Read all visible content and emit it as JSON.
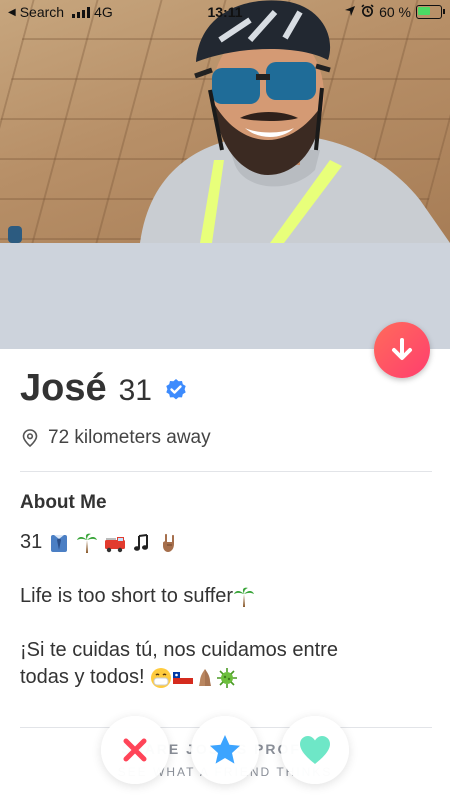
{
  "status_bar": {
    "back_label": "Search",
    "network": "4G",
    "time": "13:11",
    "battery": "60 %",
    "battery_level": 0.6
  },
  "profile": {
    "name": "José",
    "age": "31",
    "distance": "72 kilometers away"
  },
  "about": {
    "title": "About Me",
    "line1_text": "31",
    "line2": "Life is too short to suffer",
    "line3a": "¡Si te cuidas tú, nos cuidamos entre",
    "line3b": "todas y todos!"
  },
  "share": {
    "title": "SHARE JOSÉ'S PROFILE",
    "subtitle": "SEE WHAT A FRIEND THINKS"
  },
  "icons": {
    "verified": "verified-badge-icon",
    "location": "location-pin-icon",
    "down": "arrow-down-icon",
    "nope": "x-icon",
    "superlike": "star-icon",
    "like": "heart-icon"
  },
  "colors": {
    "brand_gradient_start": "#ff6b5b",
    "brand_gradient_end": "#ff3e6e",
    "verified_blue": "#3d8bfd",
    "nope_red": "#ff4458",
    "superlike_blue": "#3ca4ff",
    "like_green": "#6ee7c7"
  }
}
